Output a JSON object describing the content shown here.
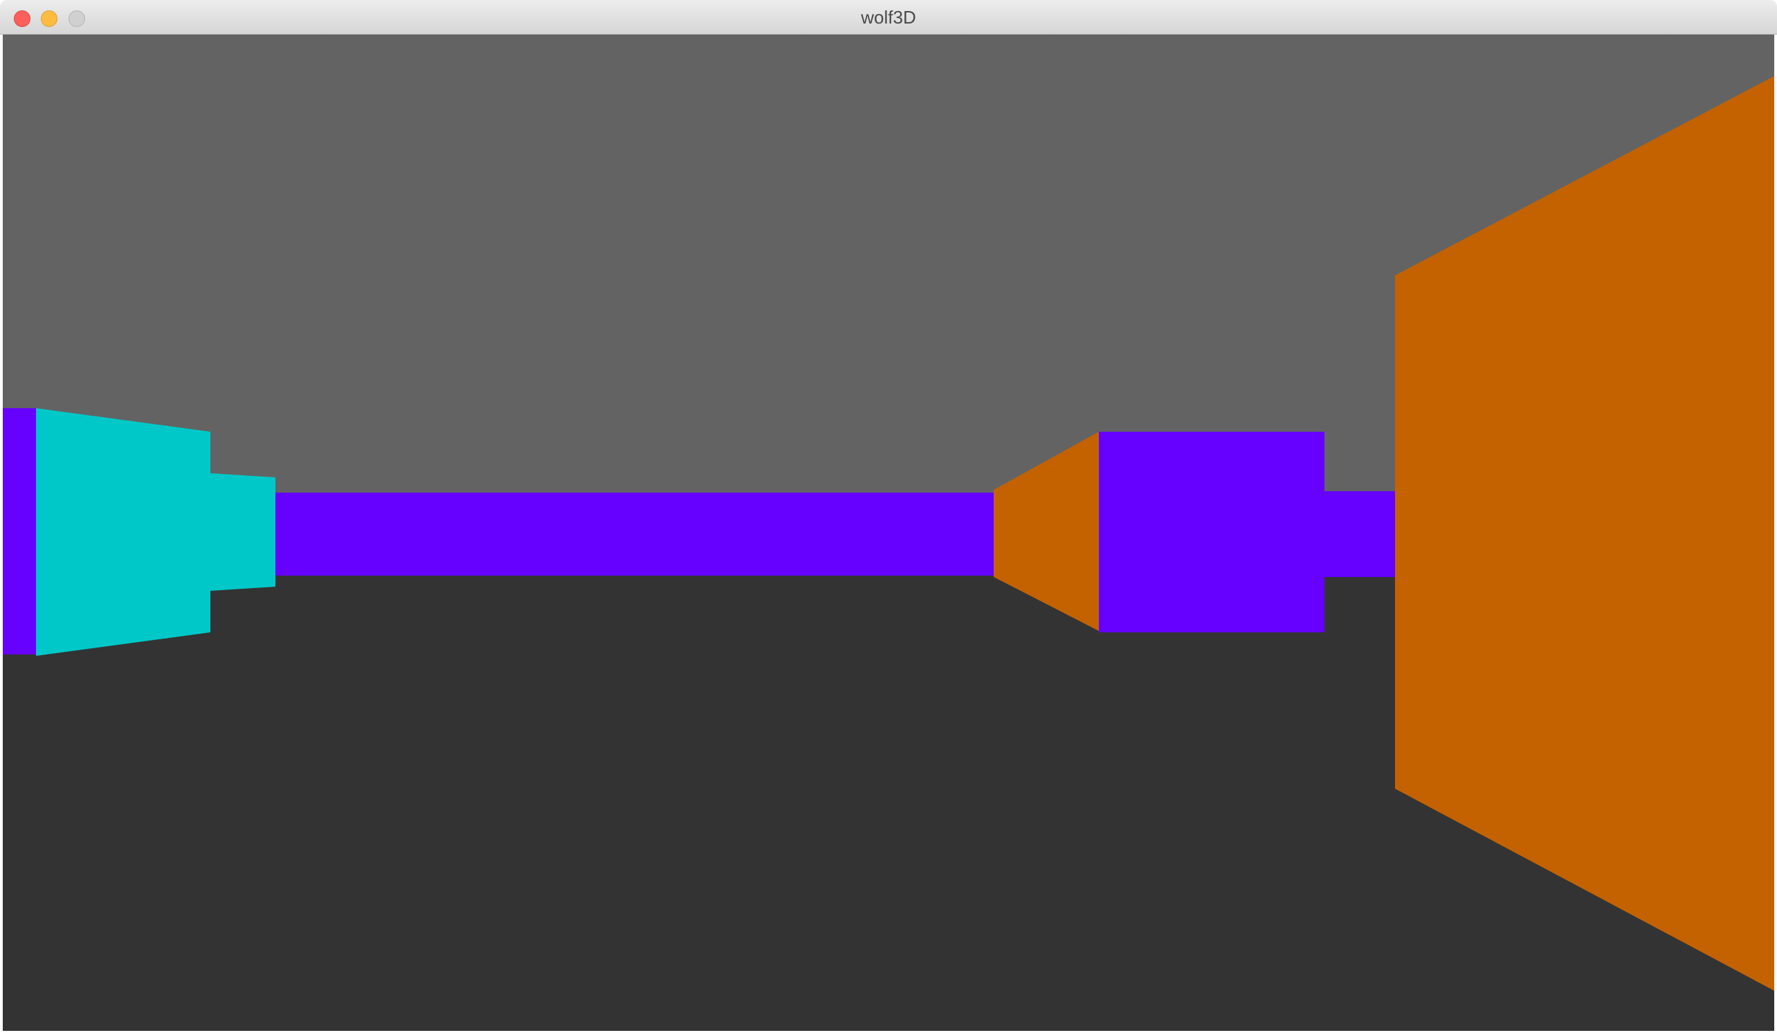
{
  "window": {
    "title": "wolf3D"
  },
  "titlebar": {
    "buttons": {
      "close": "close-icon",
      "minimize": "minimize-icon",
      "zoom": "zoom-icon"
    }
  },
  "scene": {
    "ceiling_color": "#636363",
    "floor_color": "#333333",
    "wall_colors": {
      "purple": "#6600ff",
      "cyan": "#00c8c8",
      "orange": "#c46200"
    }
  }
}
